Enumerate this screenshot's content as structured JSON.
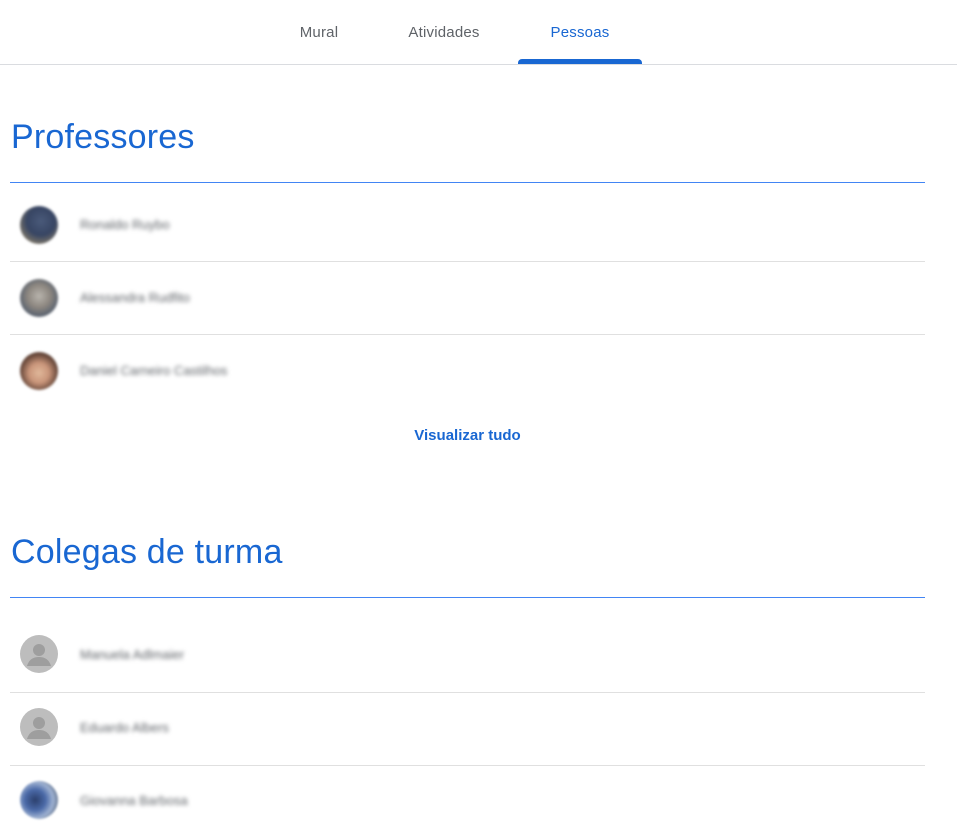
{
  "tabs": {
    "mural": "Mural",
    "atividades": "Atividades",
    "pessoas": "Pessoas",
    "active": "Pessoas"
  },
  "colors": {
    "accent": "#1967d2",
    "divider": "#e0e0e0",
    "generic_avatar": "#bdbdbd"
  },
  "professores": {
    "title": "Professores",
    "people": [
      {
        "name": "Ronaldo Ruybo"
      },
      {
        "name": "Alessandra Rudfito"
      },
      {
        "name": "Daniel Carneiro Castilhos"
      }
    ],
    "view_all": "Visualizar tudo"
  },
  "colegas": {
    "title": "Colegas de turma",
    "people": [
      {
        "name": "Manuela Adlmaier"
      },
      {
        "name": "Eduardo Albers"
      },
      {
        "name": "Giovanna Barbosa"
      }
    ]
  }
}
